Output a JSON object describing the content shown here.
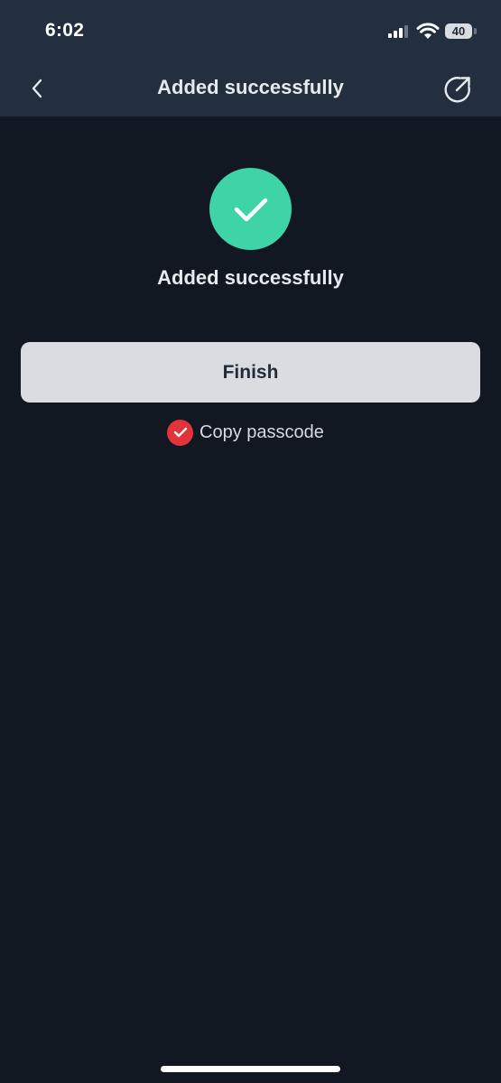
{
  "status_bar": {
    "time": "6:02",
    "battery": "40",
    "icons": [
      "signal-icon",
      "wifi-icon",
      "battery-icon"
    ]
  },
  "nav": {
    "title": "Added successfully",
    "back_icon": "chevron-left-icon",
    "share_icon": "share-external-icon"
  },
  "main": {
    "success_icon": "checkmark-icon",
    "success_message": "Added successfully",
    "finish_label": "Finish",
    "copy_passcode": {
      "label": "Copy passcode",
      "checked": true
    }
  },
  "colors": {
    "background": "#111821",
    "header": "#232f3e",
    "success_accent": "#3fd4a8",
    "checkbox_accent": "#e2333d",
    "button_bg": "#d9dde1"
  }
}
